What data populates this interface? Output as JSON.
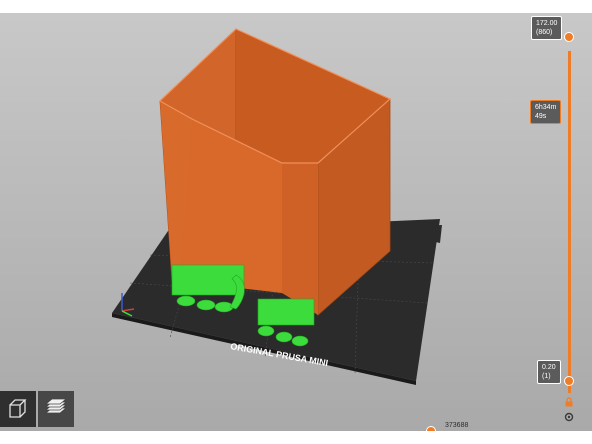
{
  "scene": {
    "bed_label": "ORIGINAL PRUSA MINI"
  },
  "vertical_slider": {
    "top_value": "172.00\n(860)",
    "estimated_time": "6h34m\n49s",
    "bottom_value": "0.20\n(1)"
  },
  "horizontal_slider": {
    "value": "373688",
    "progress": 1.0
  },
  "view_buttons": {
    "icons": [
      "3d-view-cube-icon",
      "layers-preview-icon"
    ]
  },
  "colors": {
    "model": "#d2652a",
    "support": "#3ddc3d",
    "accent": "#ef7d28",
    "bed": "#2b2b2b"
  }
}
